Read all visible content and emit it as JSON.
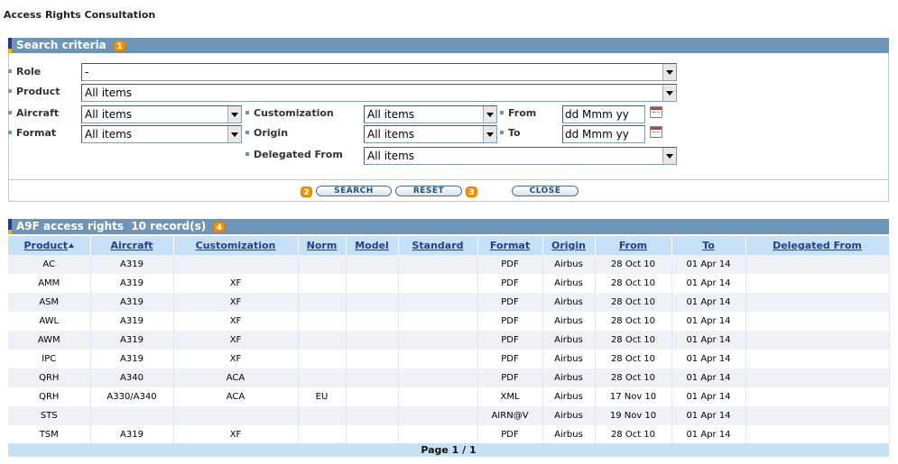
{
  "page": {
    "title": "Access Rights Consultation"
  },
  "search": {
    "header": "Search criteria",
    "header_badge": "1",
    "fields": {
      "role": {
        "label": "Role",
        "value": "-"
      },
      "product": {
        "label": "Product",
        "value": "All items"
      },
      "aircraft": {
        "label": "Aircraft",
        "value": "All items"
      },
      "format": {
        "label": "Format",
        "value": "All items"
      },
      "customization": {
        "label": "Customization",
        "value": "All items"
      },
      "origin": {
        "label": "Origin",
        "value": "All items"
      },
      "delegated_from": {
        "label": "Delegated From",
        "value": "All items"
      },
      "from": {
        "label": "From",
        "value": "dd Mmm yy"
      },
      "to": {
        "label": "To",
        "value": "dd Mmm yy"
      }
    },
    "buttons": {
      "search": "SEARCH",
      "reset": "RESET",
      "close": "CLOSE",
      "search_badge": "2",
      "reset_badge": "3"
    }
  },
  "results": {
    "header": "A9F access rights  10 record(s)",
    "header_badge": "4",
    "columns": [
      "Product",
      "Aircraft",
      "Customization",
      "Norm",
      "Model",
      "Standard",
      "Format",
      "Origin",
      "From",
      "To",
      "Delegated From"
    ],
    "sorted_column": "Product",
    "rows": [
      [
        "AC",
        "A319",
        "",
        "",
        "",
        "",
        "PDF",
        "Airbus",
        "28 Oct 10",
        "01 Apr 14",
        ""
      ],
      [
        "AMM",
        "A319",
        "XF",
        "",
        "",
        "",
        "PDF",
        "Airbus",
        "28 Oct 10",
        "01 Apr 14",
        ""
      ],
      [
        "ASM",
        "A319",
        "XF",
        "",
        "",
        "",
        "PDF",
        "Airbus",
        "28 Oct 10",
        "01 Apr 14",
        ""
      ],
      [
        "AWL",
        "A319",
        "XF",
        "",
        "",
        "",
        "PDF",
        "Airbus",
        "28 Oct 10",
        "01 Apr 14",
        ""
      ],
      [
        "AWM",
        "A319",
        "XF",
        "",
        "",
        "",
        "PDF",
        "Airbus",
        "28 Oct 10",
        "01 Apr 14",
        ""
      ],
      [
        "IPC",
        "A319",
        "XF",
        "",
        "",
        "",
        "PDF",
        "Airbus",
        "28 Oct 10",
        "01 Apr 14",
        ""
      ],
      [
        "QRH",
        "A340",
        "ACA",
        "",
        "",
        "",
        "PDF",
        "Airbus",
        "28 Oct 10",
        "01 Apr 14",
        ""
      ],
      [
        "QRH",
        "A330/A340",
        "ACA",
        "EU",
        "",
        "",
        "XML",
        "Airbus",
        "17 Nov 10",
        "01 Apr 14",
        ""
      ],
      [
        "STS",
        "",
        "",
        "",
        "",
        "",
        "AIRN@V",
        "Airbus",
        "19 Nov 10",
        "01 Apr 14",
        ""
      ],
      [
        "TSM",
        "A319",
        "XF",
        "",
        "",
        "",
        "PDF",
        "Airbus",
        "28 Oct 10",
        "01 Apr 14",
        ""
      ]
    ],
    "pager": "Page 1 / 1"
  },
  "colors": {
    "header_bg": "#6e95b5",
    "table_header_bg": "#c8e0f5",
    "badge": "#f29400"
  },
  "icons": {
    "calendar": "calendar-icon",
    "dropdown": "chevron-down-icon",
    "sort": "sort-ascending-icon"
  }
}
